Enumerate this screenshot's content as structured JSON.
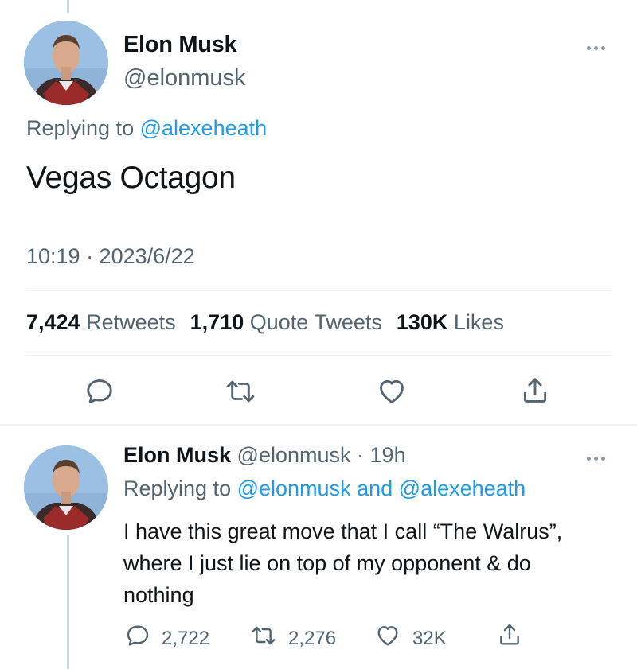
{
  "tweet": {
    "author_name": "Elon Musk",
    "author_handle": "@elonmusk",
    "replying_prefix": "Replying to",
    "replying_handle": "@alexeheath",
    "text": "Vegas Octagon",
    "timestamp": "10:19 · 2023/6/22",
    "stats": {
      "retweets_count": "7,424",
      "retweets_label": "Retweets",
      "quotes_count": "1,710",
      "quotes_label": "Quote Tweets",
      "likes_count": "130K",
      "likes_label": "Likes"
    },
    "actions": [
      "reply-icon",
      "retweet-icon",
      "like-icon",
      "share-icon"
    ]
  },
  "reply": {
    "author_name": "Elon Musk",
    "author_handle": "@elonmusk",
    "separator": "·",
    "time_ago": "19h",
    "replying_prefix": "Replying to",
    "replying_handle1": "@elonmusk",
    "replying_and": "and",
    "replying_handle2": "@alexeheath",
    "text": "I have this great move that I call “The Walrus”, where I just lie on top of my opponent & do nothing",
    "counts": {
      "replies": "2,722",
      "retweets": "2,276",
      "likes": "32K"
    }
  },
  "colors": {
    "accent": "#1d9bf0",
    "secondary_text": "#536471",
    "primary_text": "#0f1419",
    "divider": "#eff3f4"
  }
}
